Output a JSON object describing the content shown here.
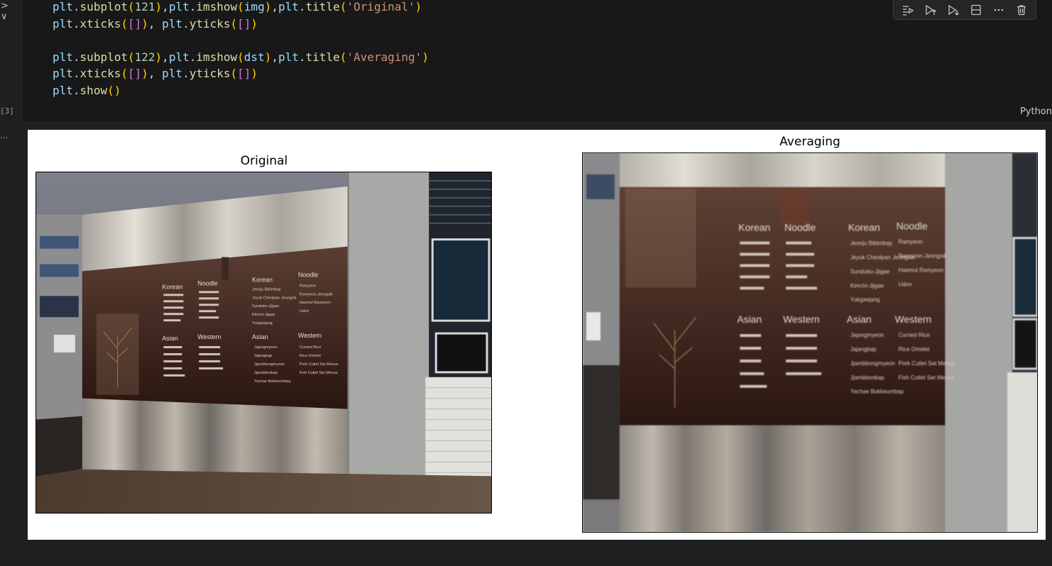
{
  "editor": {
    "gutter_chevrons": "> ∨",
    "execution_count": "[3]",
    "output_collapsed_indicator": "...",
    "language": "Python",
    "code_lines": [
      [
        {
          "t": "plt",
          "c": "var"
        },
        {
          "t": ".",
          "c": "p"
        },
        {
          "t": "subplot",
          "c": "fn"
        },
        {
          "t": "(",
          "c": "b1"
        },
        {
          "t": "121",
          "c": "num"
        },
        {
          "t": ")",
          "c": "b1"
        },
        {
          "t": ",",
          "c": "p"
        },
        {
          "t": "plt",
          "c": "var"
        },
        {
          "t": ".",
          "c": "p"
        },
        {
          "t": "imshow",
          "c": "fn"
        },
        {
          "t": "(",
          "c": "b1"
        },
        {
          "t": "img",
          "c": "var"
        },
        {
          "t": ")",
          "c": "b1"
        },
        {
          "t": ",",
          "c": "p"
        },
        {
          "t": "plt",
          "c": "var"
        },
        {
          "t": ".",
          "c": "p"
        },
        {
          "t": "title",
          "c": "fn"
        },
        {
          "t": "(",
          "c": "b1"
        },
        {
          "t": "'Original'",
          "c": "str"
        },
        {
          "t": ")",
          "c": "b1"
        }
      ],
      [
        {
          "t": "plt",
          "c": "var"
        },
        {
          "t": ".",
          "c": "p"
        },
        {
          "t": "xticks",
          "c": "fn"
        },
        {
          "t": "(",
          "c": "b1"
        },
        {
          "t": "[]",
          "c": "b2"
        },
        {
          "t": ")",
          "c": "b1"
        },
        {
          "t": ", ",
          "c": "p"
        },
        {
          "t": "plt",
          "c": "var"
        },
        {
          "t": ".",
          "c": "p"
        },
        {
          "t": "yticks",
          "c": "fn"
        },
        {
          "t": "(",
          "c": "b1"
        },
        {
          "t": "[]",
          "c": "b2"
        },
        {
          "t": ")",
          "c": "b1"
        }
      ],
      [],
      [
        {
          "t": "plt",
          "c": "var"
        },
        {
          "t": ".",
          "c": "p"
        },
        {
          "t": "subplot",
          "c": "fn"
        },
        {
          "t": "(",
          "c": "b1"
        },
        {
          "t": "122",
          "c": "num"
        },
        {
          "t": ")",
          "c": "b1"
        },
        {
          "t": ",",
          "c": "p"
        },
        {
          "t": "plt",
          "c": "var"
        },
        {
          "t": ".",
          "c": "p"
        },
        {
          "t": "imshow",
          "c": "fn"
        },
        {
          "t": "(",
          "c": "b1"
        },
        {
          "t": "dst",
          "c": "var"
        },
        {
          "t": ")",
          "c": "b1"
        },
        {
          "t": ",",
          "c": "p"
        },
        {
          "t": "plt",
          "c": "var"
        },
        {
          "t": ".",
          "c": "p"
        },
        {
          "t": "title",
          "c": "fn"
        },
        {
          "t": "(",
          "c": "b1"
        },
        {
          "t": "'Averaging'",
          "c": "str"
        },
        {
          "t": ")",
          "c": "b1"
        }
      ],
      [
        {
          "t": "plt",
          "c": "var"
        },
        {
          "t": ".",
          "c": "p"
        },
        {
          "t": "xticks",
          "c": "fn"
        },
        {
          "t": "(",
          "c": "b1"
        },
        {
          "t": "[]",
          "c": "b2"
        },
        {
          "t": ")",
          "c": "b1"
        },
        {
          "t": ", ",
          "c": "p"
        },
        {
          "t": "plt",
          "c": "var"
        },
        {
          "t": ".",
          "c": "p"
        },
        {
          "t": "yticks",
          "c": "fn"
        },
        {
          "t": "(",
          "c": "b1"
        },
        {
          "t": "[]",
          "c": "b2"
        },
        {
          "t": ")",
          "c": "b1"
        }
      ],
      [
        {
          "t": "plt",
          "c": "var"
        },
        {
          "t": ".",
          "c": "p"
        },
        {
          "t": "show",
          "c": "fn"
        },
        {
          "t": "()",
          "c": "b1"
        }
      ]
    ],
    "token_colors": {
      "var": "#9cdcfe",
      "fn": "#dcdcaa",
      "p": "#d4d4d4",
      "num": "#b5cea8",
      "str": "#ce9178",
      "b1": "#ffd700",
      "b2": "#da70d6"
    }
  },
  "toolbar": {
    "buttons": [
      {
        "icon": "run-by-line-icon"
      },
      {
        "icon": "execute-above-icon"
      },
      {
        "icon": "execute-below-icon"
      },
      {
        "icon": "split-cell-icon"
      },
      {
        "icon": "more-actions-icon"
      },
      {
        "icon": "delete-cell-icon"
      }
    ]
  },
  "output": {
    "figure": {
      "subplots": [
        {
          "title": "Original",
          "image": "photo of building wall with restaurant menu board"
        },
        {
          "title": "Averaging",
          "image": "blurred (averaged) photo of building wall with restaurant menu board"
        }
      ]
    },
    "menu_board_text": {
      "headers": [
        "Korean",
        "Noodle",
        "Korean",
        "Noodle",
        "Asian",
        "Western",
        "Asian",
        "Western"
      ],
      "items": [
        "Jeonju Bibimbap",
        "Jeyuk Cheolpan Jeongsik",
        "Sundubu-Jjigae",
        "Kimchi-Jjigae",
        "Yukgaejang",
        "Ramyeon",
        "Ramyeon-Jeongsik",
        "Haemul Ramyeon",
        "Udon",
        "Jajangmyeon",
        "Jajangbap",
        "Jjambbongmyeon",
        "Jjambbonbap",
        "Yachae Bokkeumbap",
        "Curried Rice",
        "Rice Omelet",
        "Pork Cutlet Set Menus",
        "Fish Cutlet Set Menus"
      ]
    }
  }
}
